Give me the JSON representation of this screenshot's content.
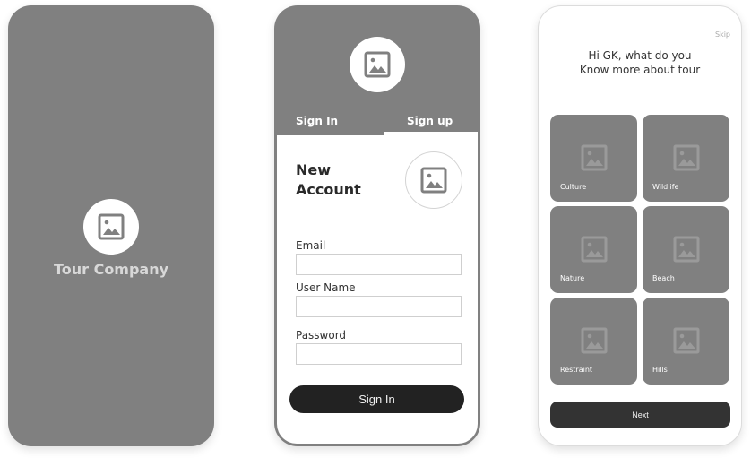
{
  "splash": {
    "logo_icon": "image-placeholder-icon",
    "brand_name": "Tour Company"
  },
  "signup": {
    "logo_icon": "image-placeholder-icon",
    "tabs": [
      {
        "label": "Sign In",
        "active": false
      },
      {
        "label": "Sign up",
        "active": true
      }
    ],
    "title_line1": "New",
    "title_line2": "Account",
    "avatar_icon": "image-placeholder-icon",
    "fields": [
      {
        "label": "Email",
        "value": "",
        "placeholder": ""
      },
      {
        "label": "User Name",
        "value": "",
        "placeholder": ""
      },
      {
        "label": "Password",
        "value": "",
        "placeholder": ""
      }
    ],
    "submit_label": "Sign In"
  },
  "interests": {
    "skip_label": "Skip",
    "greeting_line1": "Hi GK, what do you",
    "greeting_line2": "Know more about tour",
    "tiles": [
      {
        "label": "Culture",
        "icon": "image-placeholder-icon"
      },
      {
        "label": "Wildlife",
        "icon": "image-placeholder-icon"
      },
      {
        "label": "Nature",
        "icon": "image-placeholder-icon"
      },
      {
        "label": "Beach",
        "icon": "image-placeholder-icon"
      },
      {
        "label": "Restraint",
        "icon": "image-placeholder-icon"
      },
      {
        "label": "Hills",
        "icon": "image-placeholder-icon"
      }
    ],
    "next_label": "Next"
  },
  "colors": {
    "screen_gray": "#808080",
    "dark_button": "#222222",
    "next_button": "#333333",
    "white": "#ffffff"
  }
}
